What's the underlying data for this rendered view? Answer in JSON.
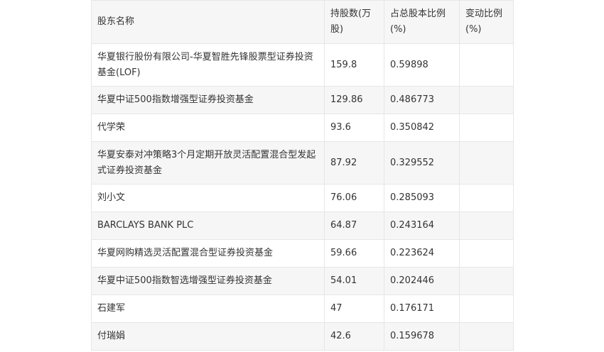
{
  "table": {
    "headers": [
      "股东名称",
      "持股数(万股)",
      "占总股本比例(%)",
      "变动比例(%)"
    ],
    "rows": [
      [
        "华夏银行股份有限公司-华夏智胜先锋股票型证券投资基金(LOF)",
        "159.8",
        "0.59898",
        ""
      ],
      [
        "华夏中证500指数增强型证券投资基金",
        "129.86",
        "0.486773",
        ""
      ],
      [
        "代学荣",
        "93.6",
        "0.350842",
        ""
      ],
      [
        "华夏安泰对冲策略3个月定期开放灵活配置混合型发起式证券投资基金",
        "87.92",
        "0.329552",
        ""
      ],
      [
        "刘小文",
        "76.06",
        "0.285093",
        ""
      ],
      [
        "BARCLAYS BANK PLC",
        "64.87",
        "0.243164",
        ""
      ],
      [
        "华夏网购精选灵活配置混合型证券投资基金",
        "59.66",
        "0.223624",
        ""
      ],
      [
        "华夏中证500指数智选增强型证券投资基金",
        "54.01",
        "0.202446",
        ""
      ],
      [
        "石建军",
        "47",
        "0.176171",
        ""
      ],
      [
        "付瑞娟",
        "42.6",
        "0.159678",
        ""
      ]
    ]
  }
}
